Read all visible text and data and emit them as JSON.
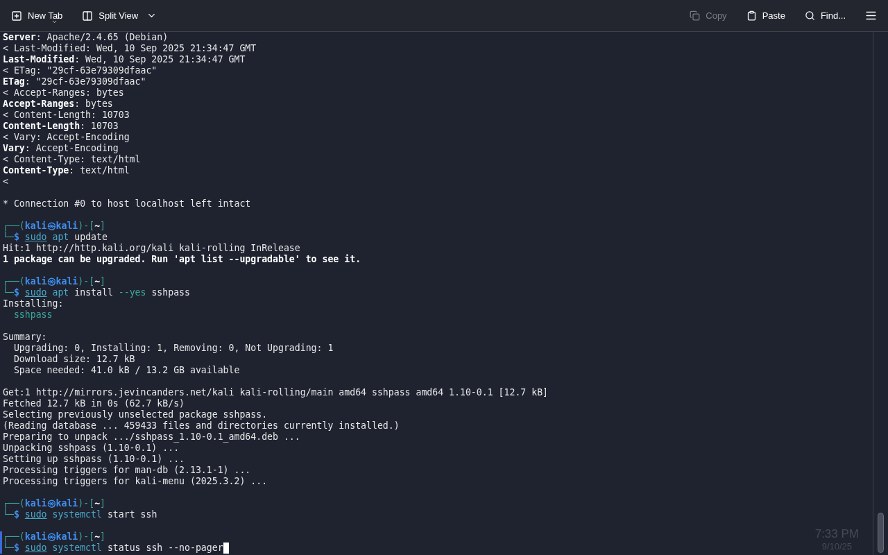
{
  "toolbar": {
    "left": [
      {
        "kind": "new_tab",
        "label": "New Tab",
        "disabled": false
      },
      {
        "kind": "split_view",
        "label": "Split View",
        "disabled": false
      }
    ],
    "right": [
      {
        "kind": "copy",
        "label": "Copy",
        "disabled": true
      },
      {
        "kind": "paste",
        "label": "Paste",
        "disabled": false
      },
      {
        "kind": "find",
        "label": "Find...",
        "disabled": false
      },
      {
        "kind": "menu",
        "disabled": false
      }
    ]
  },
  "terminal": {
    "cursor_visible": true,
    "lines": [
      {
        "kind": "output",
        "segments": [
          {
            "text": "Server",
            "kind": "bold"
          },
          {
            "text": ": Apache/2.4.65 (Debian)",
            "kind": "plain"
          }
        ]
      },
      {
        "kind": "output",
        "segments": [
          {
            "text": "< Last-Modified: Wed, 10 Sep 2025 21:34:47 GMT",
            "kind": "plain"
          }
        ]
      },
      {
        "kind": "output",
        "segments": [
          {
            "text": "Last-Modified",
            "kind": "bold"
          },
          {
            "text": ": Wed, 10 Sep 2025 21:34:47 GMT",
            "kind": "plain"
          }
        ]
      },
      {
        "kind": "output",
        "segments": [
          {
            "text": "< ETag: \"29cf-63e79309dfaac\"",
            "kind": "plain"
          }
        ]
      },
      {
        "kind": "output",
        "segments": [
          {
            "text": "ETag",
            "kind": "bold"
          },
          {
            "text": ": \"29cf-63e79309dfaac\"",
            "kind": "plain"
          }
        ]
      },
      {
        "kind": "output",
        "segments": [
          {
            "text": "< Accept-Ranges: bytes",
            "kind": "plain"
          }
        ]
      },
      {
        "kind": "output",
        "segments": [
          {
            "text": "Accept-Ranges",
            "kind": "bold"
          },
          {
            "text": ": bytes",
            "kind": "plain"
          }
        ]
      },
      {
        "kind": "output",
        "segments": [
          {
            "text": "< Content-Length: 10703",
            "kind": "plain"
          }
        ]
      },
      {
        "kind": "output",
        "segments": [
          {
            "text": "Content-Length",
            "kind": "bold"
          },
          {
            "text": ": 10703",
            "kind": "plain"
          }
        ]
      },
      {
        "kind": "output",
        "segments": [
          {
            "text": "< Vary: Accept-Encoding",
            "kind": "plain"
          }
        ]
      },
      {
        "kind": "output",
        "segments": [
          {
            "text": "Vary",
            "kind": "bold"
          },
          {
            "text": ": Accept-Encoding",
            "kind": "plain"
          }
        ]
      },
      {
        "kind": "output",
        "segments": [
          {
            "text": "< Content-Type: text/html",
            "kind": "plain"
          }
        ]
      },
      {
        "kind": "output",
        "segments": [
          {
            "text": "Content-Type",
            "kind": "bold"
          },
          {
            "text": ": text/html",
            "kind": "plain"
          }
        ]
      },
      {
        "kind": "output",
        "segments": [
          {
            "text": "<",
            "kind": "plain"
          }
        ]
      },
      {
        "kind": "blank"
      },
      {
        "kind": "output",
        "segments": [
          {
            "text": "* Connection #0 to host localhost left intact",
            "kind": "plain"
          }
        ]
      },
      {
        "kind": "blank"
      },
      {
        "kind": "output",
        "segments": [
          {
            "text": "┌──(",
            "kind": "frame"
          },
          {
            "text": "kali㉿kali",
            "kind": "user"
          },
          {
            "text": ")-[",
            "kind": "frame"
          },
          {
            "text": "~",
            "kind": "dir"
          },
          {
            "text": "]",
            "kind": "frame"
          }
        ]
      },
      {
        "kind": "command",
        "segments": [
          {
            "text": "└─",
            "kind": "frame"
          },
          {
            "text": "$",
            "kind": "user"
          }
        ],
        "words": [
          {
            "text": "sudo",
            "kind": "sudo"
          },
          {
            "text": "apt",
            "kind": "program"
          },
          {
            "text": "update",
            "kind": "plain"
          }
        ]
      },
      {
        "kind": "output",
        "segments": [
          {
            "text": "Hit:1 http://http.kali.org/kali kali-rolling InRelease",
            "kind": "plain"
          }
        ]
      },
      {
        "kind": "output",
        "segments": [
          {
            "text": "1 package can be upgraded. Run 'apt list --upgradable' to see it.",
            "kind": "bold"
          }
        ]
      },
      {
        "kind": "blank"
      },
      {
        "kind": "output",
        "segments": [
          {
            "text": "┌──(",
            "kind": "frame"
          },
          {
            "text": "kali㉿kali",
            "kind": "user"
          },
          {
            "text": ")-[",
            "kind": "frame"
          },
          {
            "text": "~",
            "kind": "dir"
          },
          {
            "text": "]",
            "kind": "frame"
          }
        ]
      },
      {
        "kind": "command",
        "segments": [
          {
            "text": "└─",
            "kind": "frame"
          },
          {
            "text": "$",
            "kind": "user"
          }
        ],
        "words": [
          {
            "text": "sudo",
            "kind": "sudo"
          },
          {
            "text": "apt",
            "kind": "program"
          },
          {
            "text": "install",
            "kind": "plain"
          },
          {
            "text": "--yes",
            "kind": "option"
          },
          {
            "text": "sshpass",
            "kind": "plain"
          }
        ]
      },
      {
        "kind": "output",
        "segments": [
          {
            "text": "Installing:",
            "kind": "plain"
          }
        ]
      },
      {
        "kind": "output",
        "segments": [
          {
            "text": "  sshpass",
            "kind": "option"
          }
        ]
      },
      {
        "kind": "blank"
      },
      {
        "kind": "output",
        "segments": [
          {
            "text": "Summary:",
            "kind": "plain"
          }
        ]
      },
      {
        "kind": "output",
        "segments": [
          {
            "text": "  Upgrading: 0, Installing: 1, Removing: 0, Not Upgrading: 1",
            "kind": "plain"
          }
        ]
      },
      {
        "kind": "output",
        "segments": [
          {
            "text": "  Download size: 12.7 kB",
            "kind": "plain"
          }
        ]
      },
      {
        "kind": "output",
        "segments": [
          {
            "text": "  Space needed: 41.0 kB / 13.2 GB available",
            "kind": "plain"
          }
        ]
      },
      {
        "kind": "blank"
      },
      {
        "kind": "output",
        "segments": [
          {
            "text": "Get:1 http://mirrors.jevincanders.net/kali kali-rolling/main amd64 sshpass amd64 1.10-0.1 [12.7 kB]",
            "kind": "plain"
          }
        ]
      },
      {
        "kind": "output",
        "segments": [
          {
            "text": "Fetched 12.7 kB in 0s (62.7 kB/s)",
            "kind": "plain"
          }
        ]
      },
      {
        "kind": "output",
        "segments": [
          {
            "text": "Selecting previously unselected package sshpass.",
            "kind": "plain"
          }
        ]
      },
      {
        "kind": "output",
        "segments": [
          {
            "text": "(Reading database ... 459433 files and directories currently installed.)",
            "kind": "plain"
          }
        ]
      },
      {
        "kind": "output",
        "segments": [
          {
            "text": "Preparing to unpack .../sshpass_1.10-0.1_amd64.deb ...",
            "kind": "plain"
          }
        ]
      },
      {
        "kind": "output",
        "segments": [
          {
            "text": "Unpacking sshpass (1.10-0.1) ...",
            "kind": "plain"
          }
        ]
      },
      {
        "kind": "output",
        "segments": [
          {
            "text": "Setting up sshpass (1.10-0.1) ...",
            "kind": "plain"
          }
        ]
      },
      {
        "kind": "output",
        "segments": [
          {
            "text": "Processing triggers for man-db (2.13.1-1) ...",
            "kind": "plain"
          }
        ]
      },
      {
        "kind": "output",
        "segments": [
          {
            "text": "Processing triggers for kali-menu (2025.3.2) ...",
            "kind": "plain"
          }
        ]
      },
      {
        "kind": "blank"
      },
      {
        "kind": "output",
        "segments": [
          {
            "text": "┌──(",
            "kind": "frame"
          },
          {
            "text": "kali㉿kali",
            "kind": "user"
          },
          {
            "text": ")-[",
            "kind": "frame"
          },
          {
            "text": "~",
            "kind": "dir"
          },
          {
            "text": "]",
            "kind": "frame"
          }
        ]
      },
      {
        "kind": "command",
        "segments": [
          {
            "text": "└─",
            "kind": "frame"
          },
          {
            "text": "$",
            "kind": "user"
          }
        ],
        "words": [
          {
            "text": "sudo",
            "kind": "sudo"
          },
          {
            "text": "systemctl",
            "kind": "program"
          },
          {
            "text": "start",
            "kind": "plain"
          },
          {
            "text": "ssh",
            "kind": "plain"
          }
        ]
      },
      {
        "kind": "blank"
      },
      {
        "kind": "output",
        "segments": [
          {
            "text": "┌──(",
            "kind": "frame"
          },
          {
            "text": "kali㉿kali",
            "kind": "user"
          },
          {
            "text": ")-[",
            "kind": "frame"
          },
          {
            "text": "~",
            "kind": "dir"
          },
          {
            "text": "]",
            "kind": "frame"
          }
        ]
      },
      {
        "kind": "command",
        "segments": [
          {
            "text": "└─",
            "kind": "frame"
          },
          {
            "text": "$",
            "kind": "user"
          }
        ],
        "words": [
          {
            "text": "sudo",
            "kind": "sudo"
          },
          {
            "text": "systemctl",
            "kind": "program"
          },
          {
            "text": "status",
            "kind": "plain"
          },
          {
            "text": "ssh",
            "kind": "plain"
          },
          {
            "text": "--no-pager",
            "kind": "plain"
          }
        ]
      }
    ]
  },
  "background_clock": {
    "time": "7:33 PM",
    "date": "9/10/25"
  }
}
